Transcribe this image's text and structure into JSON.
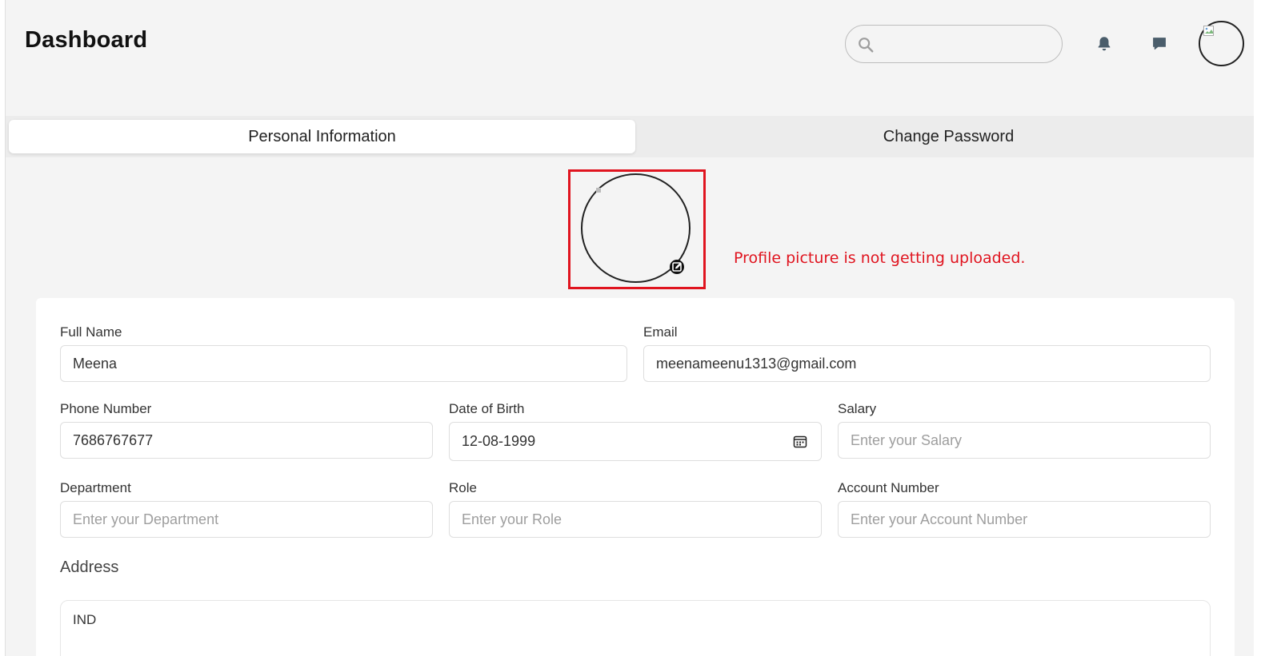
{
  "header": {
    "title": "Dashboard",
    "search_placeholder": ""
  },
  "tabs": [
    {
      "label": "Personal Information",
      "active": true
    },
    {
      "label": "Change Password",
      "active": false
    }
  ],
  "annotation": {
    "text": "Profile picture is not getting uploaded.",
    "color": "#e0141f"
  },
  "form": {
    "full_name": {
      "label": "Full Name",
      "value": "Meena",
      "placeholder": ""
    },
    "email": {
      "label": "Email",
      "value": "meenameenu1313@gmail.com",
      "placeholder": ""
    },
    "phone": {
      "label": "Phone Number",
      "value": "7686767677",
      "placeholder": ""
    },
    "dob": {
      "label": "Date of Birth",
      "value": "12-08-1999",
      "placeholder": ""
    },
    "salary": {
      "label": "Salary",
      "value": "",
      "placeholder": "Enter your Salary"
    },
    "department": {
      "label": "Department",
      "value": "",
      "placeholder": "Enter your Department"
    },
    "role": {
      "label": "Role",
      "value": "",
      "placeholder": "Enter your Role"
    },
    "account_number": {
      "label": "Account Number",
      "value": "",
      "placeholder": "Enter your Account Number"
    },
    "address": {
      "label": "Address",
      "value": "IND"
    }
  },
  "icons": {
    "search": "search-icon",
    "notifications": "bell-icon",
    "messages": "chat-icon",
    "avatar": "avatar",
    "edit_photo": "edit-photo-icon",
    "calendar": "calendar-icon"
  },
  "colors": {
    "background": "#f4f4f4",
    "annotation_red": "#e0141f",
    "icon_slate": "#4a5d6b"
  }
}
